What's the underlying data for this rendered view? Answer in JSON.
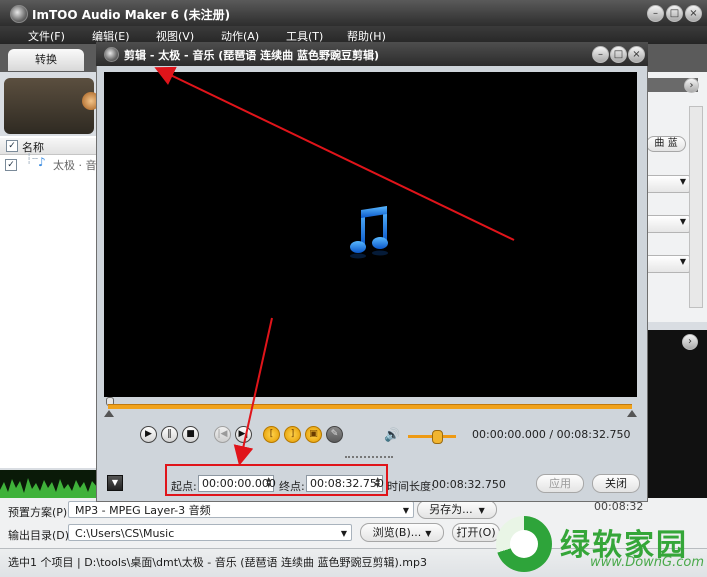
{
  "main": {
    "title": "ImTOO Audio Maker 6 (未注册)",
    "menu": [
      "文件(F)",
      "编辑(E)",
      "视图(V)",
      "动作(A)",
      "工具(T)",
      "帮助(H)"
    ],
    "tab_convert": "转换",
    "list": {
      "header": "名称",
      "row_label": "太极 · 音"
    },
    "right_button": "曲  蓝",
    "profile_label": "预置方案(P):",
    "profile_value": "MP3 - MPEG Layer-3 音频",
    "save_as_label": "另存为...",
    "output_label": "输出目录(D):",
    "output_value": "C:\\Users\\CS\\Music",
    "browse_label": "浏览(B)...",
    "open_label": "打开(O)",
    "partial_time": "00:08:32",
    "status_text": "选中1 个项目 | D:\\tools\\桌面\\dmt\\太极 - 音乐 (琵琶语 连续曲 蓝色野豌豆剪辑).mp3"
  },
  "dialog": {
    "title": "剪辑 - 太极 - 音乐 (琵琶语 连续曲 蓝色野豌豆剪辑)",
    "time_display": "00:00:00.000 / 00:08:32.750",
    "start_label": "起点:",
    "start_value": "00:00:00.000",
    "end_label": "终点:",
    "end_value": "00:08:32.750",
    "duration_label": "时间长度:",
    "duration_value": "00:08:32.750",
    "apply_label": "应用",
    "close_label": "关闭",
    "volume_level": 0.6
  },
  "watermark": {
    "text": "绿软家园",
    "url": "www.DownG.com"
  },
  "colors": {
    "accent": "#f0a21c",
    "highlight": "#e0141a",
    "video_bg": "#000000",
    "note_blue": "#1a8fff"
  }
}
